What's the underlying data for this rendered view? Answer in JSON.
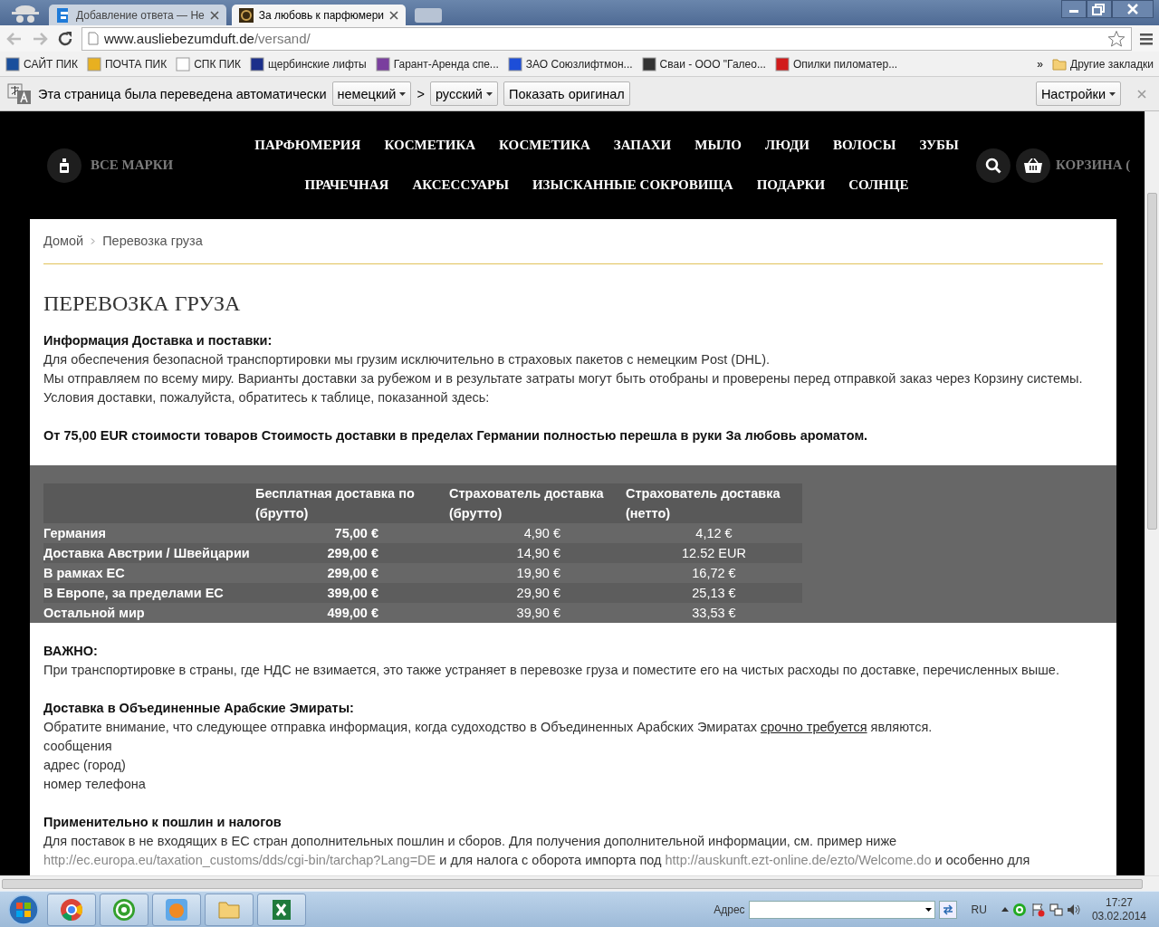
{
  "browser": {
    "tabs": [
      {
        "title": "Добавление ответа — Не",
        "selected": false
      },
      {
        "title": "За любовь к парфюмери",
        "selected": true
      }
    ],
    "address": {
      "host": "www.ausliebezumduft.de",
      "path": "/versand/"
    },
    "bookmarks": [
      {
        "label": "САЙТ ПИК"
      },
      {
        "label": "ПОЧТА ПИК"
      },
      {
        "label": "СПК ПИК"
      },
      {
        "label": "щербинские лифты"
      },
      {
        "label": "Гарант-Аренда спе..."
      },
      {
        "label": "ЗАО Союзлифтмон..."
      },
      {
        "label": "Сваи - ООО \"Галео..."
      },
      {
        "label": "Опилки пиломатер..."
      }
    ],
    "bookmarks_more": "»",
    "other_bookmarks": "Другие закладки"
  },
  "translate_bar": {
    "message": "Эта страница была переведена автоматически",
    "from_language": "немецкий",
    "separator": ">",
    "to_language": "русский",
    "show_original": "Показать оригинал",
    "settings": "Настройки"
  },
  "site_header": {
    "brands": "ВСЕ МАРКИ",
    "menu_rows": [
      [
        "ПАРФЮМЕРИЯ",
        "КОСМЕТИКА",
        "КОСМЕТИКА",
        "ЗАПАХИ",
        "МЫЛО",
        "ЛЮДИ",
        "ВОЛОСЫ",
        "ЗУБЫ"
      ],
      [
        "ПРАЧЕЧНАЯ",
        "АКСЕССУАРЫ",
        "ИЗЫСКАННЫЕ СОКРОВИЩА",
        "ПОДАРКИ",
        "СОЛНЦЕ"
      ]
    ],
    "cart": "КОРЗИНА ("
  },
  "breadcrumb": [
    "Домой",
    "Перевозка груза"
  ],
  "page_title": "ПЕРЕВОЗКА ГРУЗА",
  "intro": {
    "heading": "Информация Доставка и поставки:",
    "lines": [
      "Для обеспечения безопасной транспортировки мы грузим исключительно в страховых пакетов с немецким Post (DHL).",
      "Мы отправляем по всему миру. Варианты доставки за рубежом и в результате затраты могут быть отобраны и проверены перед отправкой заказ через Корзину системы.",
      "Условия доставки, пожалуйста, обратитесь к таблице, показанной здесь:"
    ]
  },
  "notice": "От 75,00 EUR стоимости товаров Стоимость доставки в пределах Германии полностью перешла в руки За любовь ароматом.",
  "table": {
    "columns": [
      "Бесплатная доставка по (брутто)",
      "Страхователь доставка (брутто)",
      "Страхователь доставка (нетто)"
    ],
    "rows": [
      {
        "region": "Германия",
        "values": [
          "75,00 €",
          "4,90 €",
          "4,12 €"
        ]
      },
      {
        "region": "Доставка Австрии / Швейцарии",
        "values": [
          "299,00 €",
          "14,90 €",
          "12.52 EUR"
        ]
      },
      {
        "region": "В рамках ЕС",
        "values": [
          "299,00 €",
          "19,90 €",
          "16,72 €"
        ]
      },
      {
        "region": "В Европе, за пределами ЕС",
        "values": [
          "399,00 €",
          "29,90 €",
          "25,13 €"
        ]
      },
      {
        "region": "Остальной мир",
        "values": [
          "499,00 €",
          "39,90 €",
          "33,53 €"
        ]
      }
    ]
  },
  "sections": [
    {
      "heading": "ВАЖНО:",
      "lines": [
        [
          {
            "kind": "text",
            "text": "При транспортировке в страны, где НДС не взимается, это также устраняет в перевозке груза и поместите его на чистых расходы по доставке, перечисленных выше."
          }
        ]
      ]
    },
    {
      "heading": "Доставка в Объединенные Арабские Эмираты:",
      "lines": [
        [
          {
            "kind": "text",
            "text": "Обратите внимание, что следующее отправка информация, когда судоходство в Объединенных Арабских Эмиратах "
          },
          {
            "kind": "link",
            "text": "срочно требуется"
          },
          {
            "kind": "text",
            "text": " являются."
          }
        ],
        [
          {
            "kind": "text",
            "text": "сообщения"
          }
        ],
        [
          {
            "kind": "text",
            "text": "адрес (город)"
          }
        ],
        [
          {
            "kind": "text",
            "text": "номер телефона"
          }
        ]
      ]
    },
    {
      "heading": "Применительно к пошлин и налогов",
      "lines": [
        [
          {
            "kind": "text",
            "text": "Для поставок в не входящих в ЕС стран дополнительных пошлин и сборов. Для получения дополнительной информации, см. пример ниже"
          }
        ],
        [
          {
            "kind": "url",
            "text": "http://ec.europa.eu/taxation_customs/dds/cgi-bin/tarchap?Lang=DE"
          },
          {
            "kind": "text",
            "text": " и для налога с оборота импорта под "
          },
          {
            "kind": "url",
            "text": "http://auskunft.ezt-online.de/ezto/Welcome.do"
          },
          {
            "kind": "text",
            "text": " и особенно для"
          }
        ]
      ]
    }
  ],
  "taskbar": {
    "address_label": "Адрес",
    "language": "RU",
    "time": "17:27",
    "date": "03.02.2014"
  }
}
